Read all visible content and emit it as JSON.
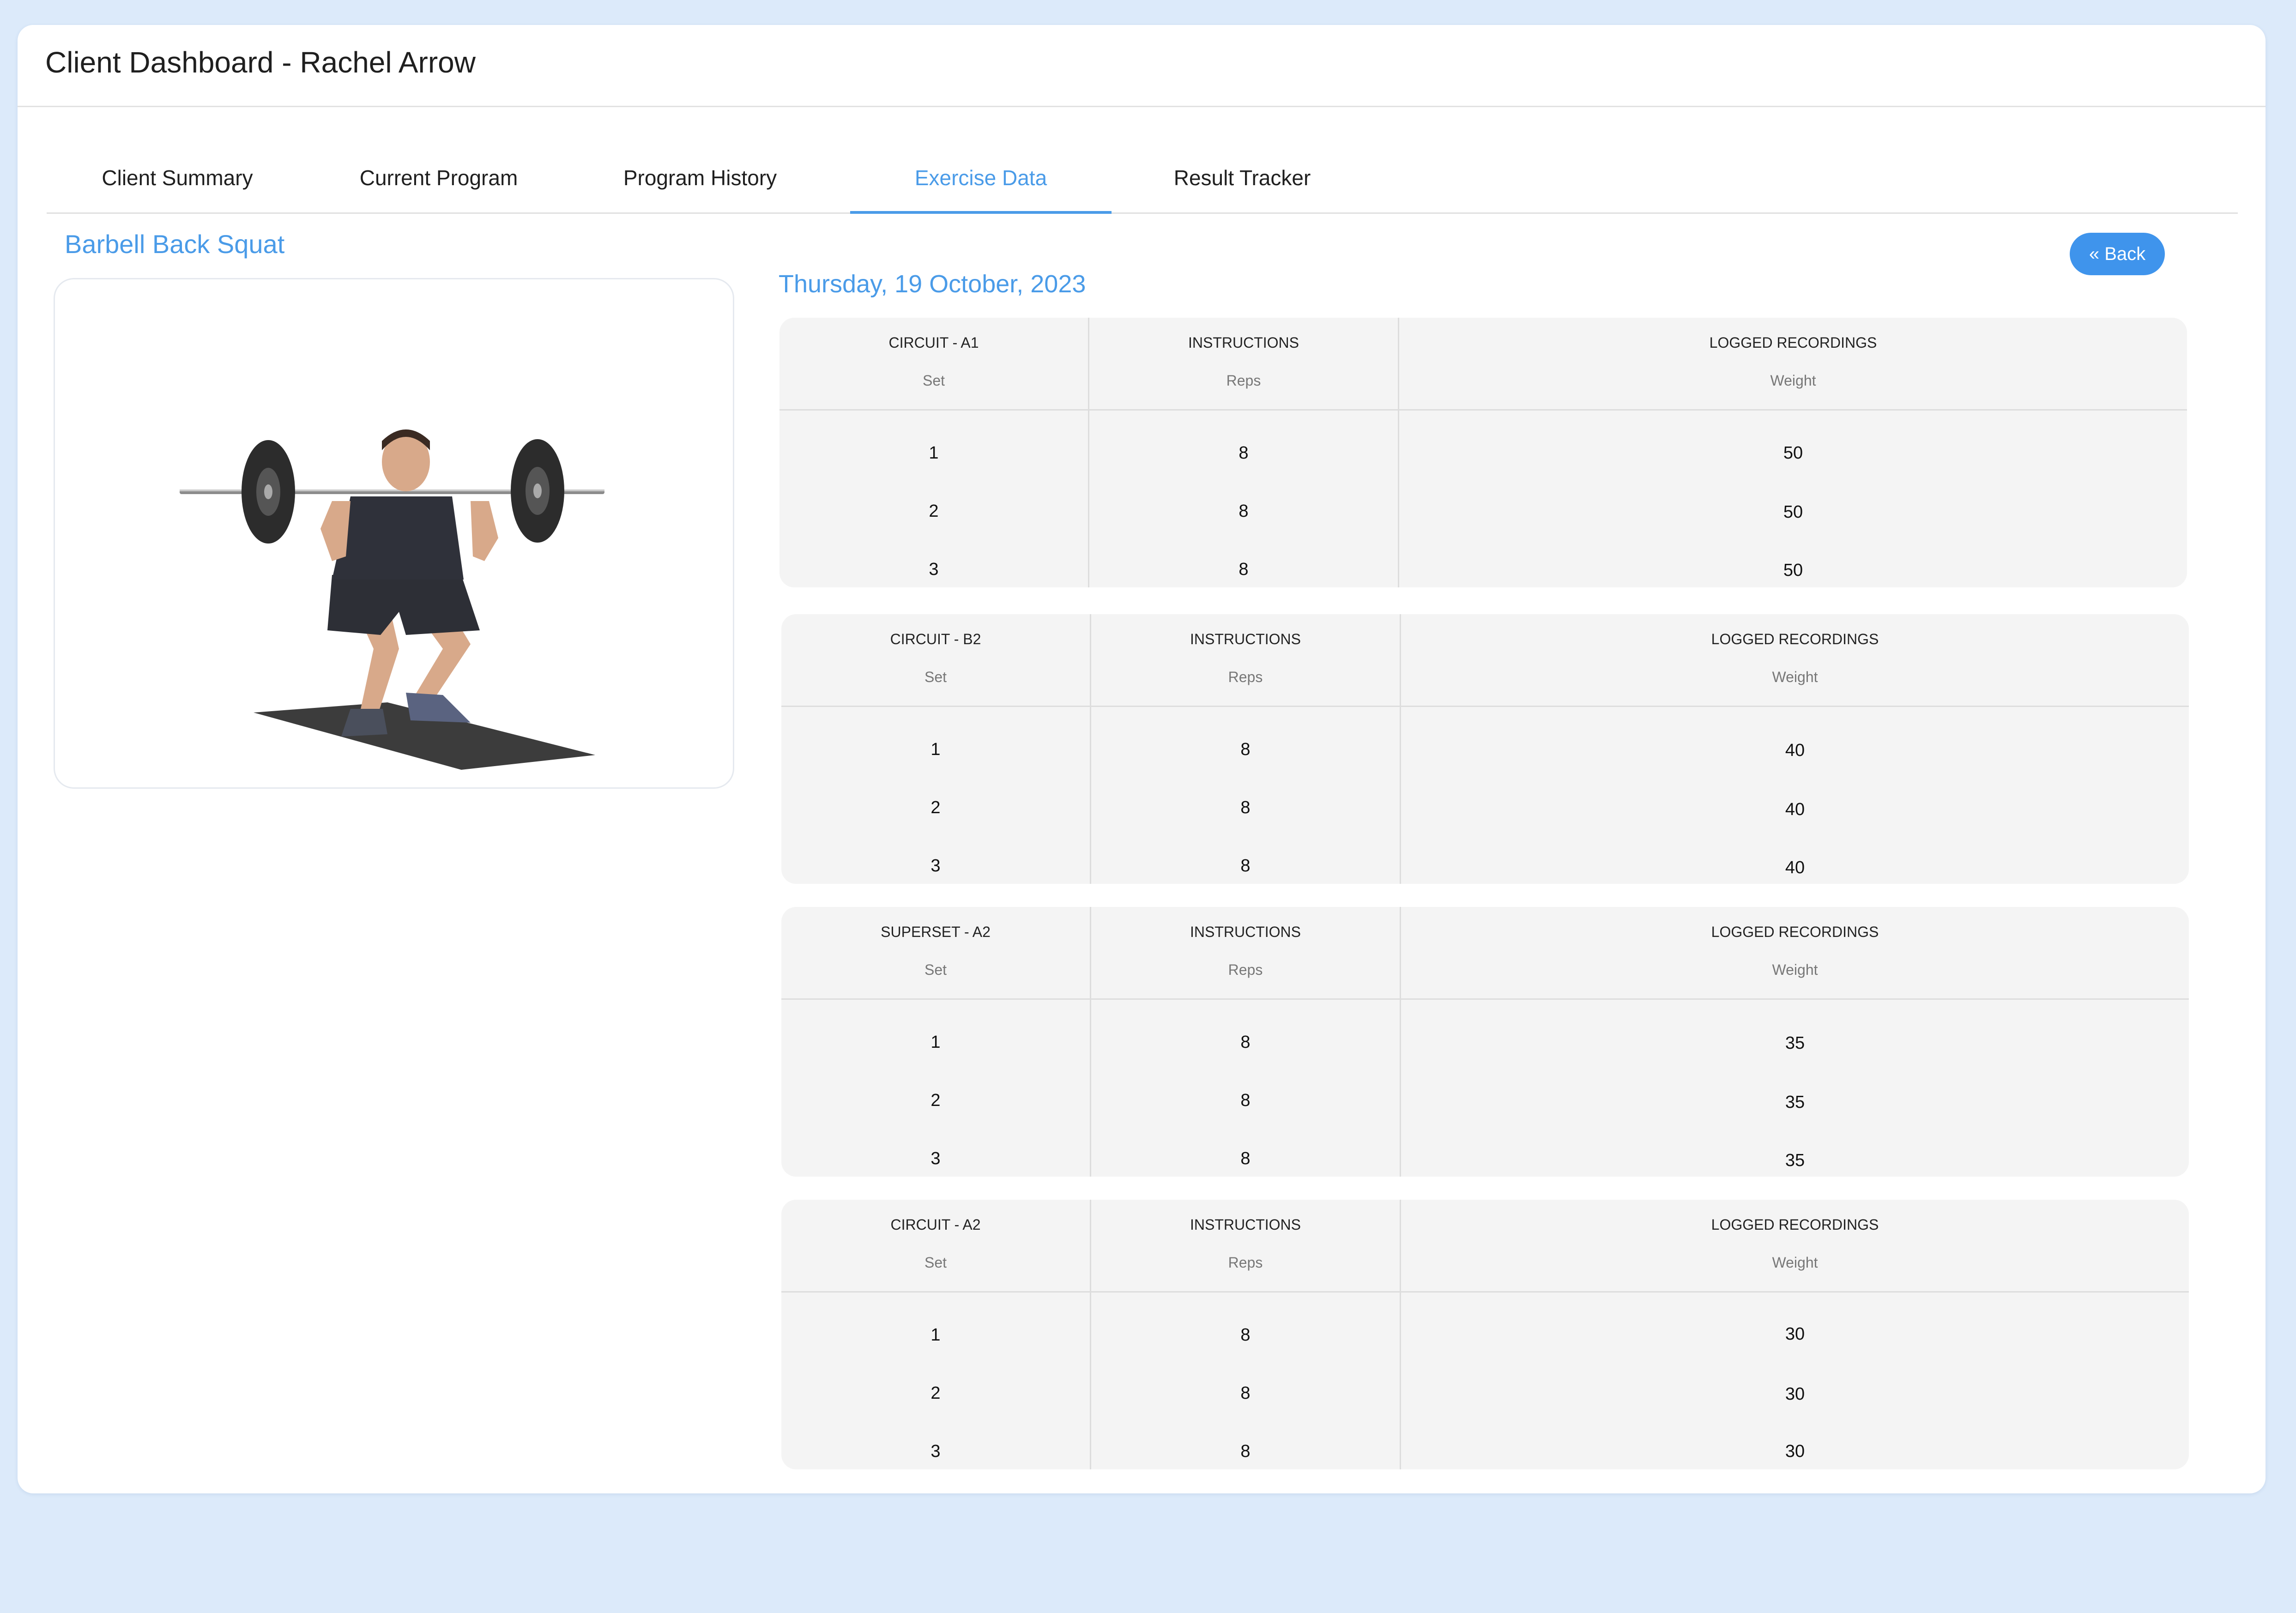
{
  "header": {
    "title": "Client Dashboard - Rachel Arrow"
  },
  "tabs": [
    {
      "label": "Client Summary",
      "active": false
    },
    {
      "label": "Current Program",
      "active": false
    },
    {
      "label": "Program History",
      "active": false
    },
    {
      "label": "Exercise Data",
      "active": true
    },
    {
      "label": "Result Tracker",
      "active": false
    }
  ],
  "exercise": {
    "name": "Barbell Back Squat"
  },
  "back_button": {
    "label": "« Back",
    "icon": "double-chevron-left-icon"
  },
  "session": {
    "date": "Thursday, 19 October, 2023"
  },
  "colors": {
    "accent": "#4a9be8",
    "button": "#3f94ec",
    "page_bg": "#dceafa",
    "panel_bg": "#f4f4f4"
  },
  "tables": [
    {
      "group": "CIRCUIT - A1",
      "instructions_header": "INSTRUCTIONS",
      "recordings_header": "LOGGED RECORDINGS",
      "set_label": "Set",
      "reps_label": "Reps",
      "weight_label": "Weight",
      "rows": [
        {
          "set": "1",
          "reps": "8",
          "weight": "50"
        },
        {
          "set": "2",
          "reps": "8",
          "weight": "50"
        },
        {
          "set": "3",
          "reps": "8",
          "weight": "50"
        }
      ]
    },
    {
      "group": "CIRCUIT - B2",
      "instructions_header": "INSTRUCTIONS",
      "recordings_header": "LOGGED RECORDINGS",
      "set_label": "Set",
      "reps_label": "Reps",
      "weight_label": "Weight",
      "rows": [
        {
          "set": "1",
          "reps": "8",
          "weight": "40"
        },
        {
          "set": "2",
          "reps": "8",
          "weight": "40"
        },
        {
          "set": "3",
          "reps": "8",
          "weight": "40"
        }
      ]
    },
    {
      "group": "SUPERSET - A2",
      "instructions_header": "INSTRUCTIONS",
      "recordings_header": "LOGGED RECORDINGS",
      "set_label": "Set",
      "reps_label": "Reps",
      "weight_label": "Weight",
      "rows": [
        {
          "set": "1",
          "reps": "8",
          "weight": "35"
        },
        {
          "set": "2",
          "reps": "8",
          "weight": "35"
        },
        {
          "set": "3",
          "reps": "8",
          "weight": "35"
        }
      ]
    },
    {
      "group": "CIRCUIT - A2",
      "instructions_header": "INSTRUCTIONS",
      "recordings_header": "LOGGED RECORDINGS",
      "set_label": "Set",
      "reps_label": "Reps",
      "weight_label": "Weight",
      "rows": [
        {
          "set": "1",
          "reps": "8",
          "weight": "30"
        },
        {
          "set": "2",
          "reps": "8",
          "weight": "30"
        },
        {
          "set": "3",
          "reps": "8",
          "weight": "30"
        }
      ]
    }
  ]
}
